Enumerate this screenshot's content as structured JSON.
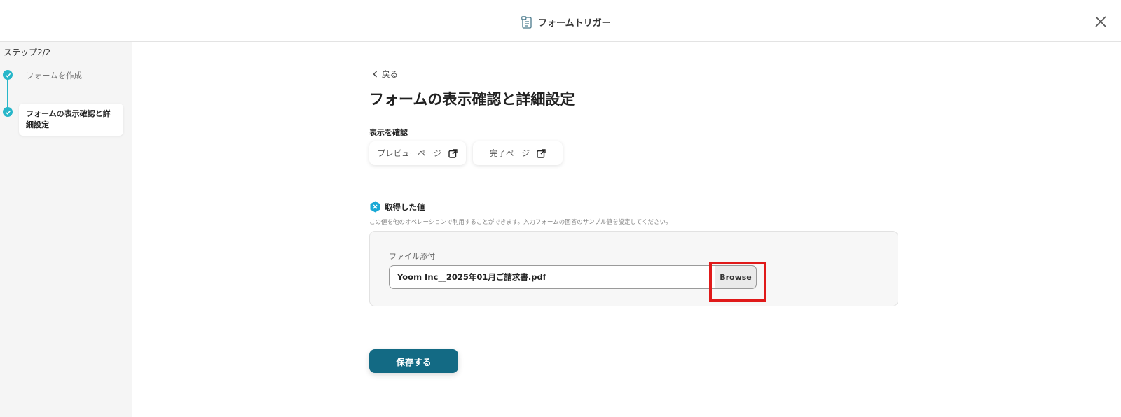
{
  "header": {
    "title": "フォームトリガー",
    "icon": "form-icon",
    "close_icon": "close-icon"
  },
  "sidebar": {
    "step_count": "ステップ2/2",
    "steps": [
      {
        "label": "フォームを作成",
        "status": "done"
      },
      {
        "label": "フォームの表示確認と詳細設定",
        "status": "current"
      }
    ]
  },
  "main": {
    "back_label": "戻る",
    "title": "フォームの表示確認と詳細設定",
    "display_section_label": "表示を確認",
    "preview_button": "プレビューページ",
    "complete_button": "完了ページ",
    "acquired_title": "取得した値",
    "acquired_description": "この値を他のオペレーションで利用することができます。入力フォームの回答のサンプル値を設定してください。",
    "file_field_label": "ファイル添付",
    "file_field_value": "Yoom Inc__2025年01月ご請求書.pdf",
    "browse_label": "Browse",
    "save_label": "保存する"
  },
  "colors": {
    "accent": "#27b6c9",
    "primary_button": "#136a84",
    "highlight": "#e01a1a"
  }
}
